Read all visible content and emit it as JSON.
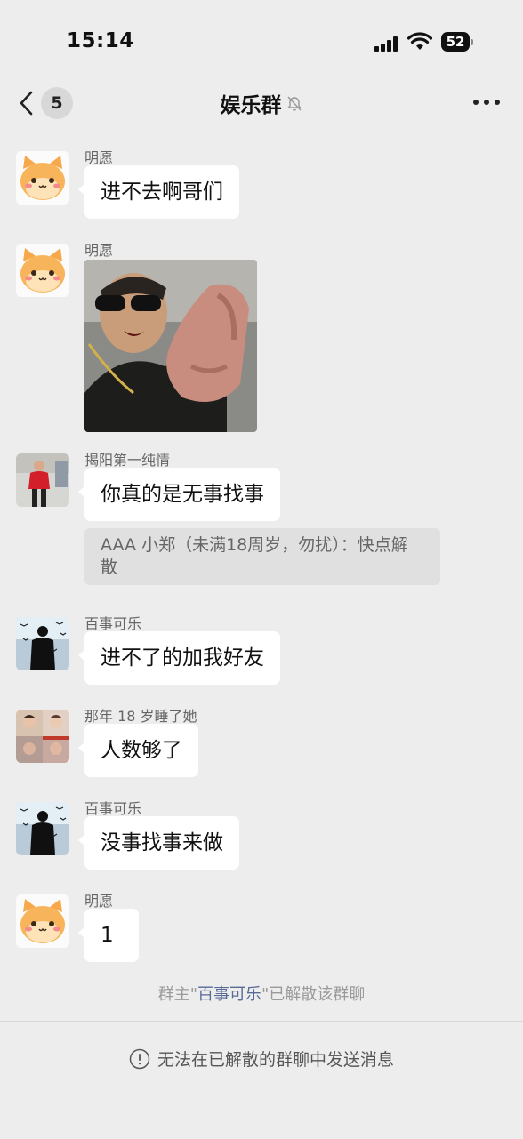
{
  "status_bar": {
    "time": "15:14",
    "battery": "52",
    "icons": [
      "cellular-signal-icon",
      "wifi-icon",
      "battery-icon"
    ]
  },
  "nav": {
    "back_icon": "chevron-left-icon",
    "unread_count": "5",
    "title": "娱乐群",
    "mute_icon": "muted-bell-icon",
    "more_icon": "more-dots-icon"
  },
  "messages": [
    {
      "sender": "明愿",
      "text": "进不去啊哥们",
      "avatar": "cartoon-cat-avatar"
    },
    {
      "sender": "明愿",
      "type": "image",
      "avatar": "cartoon-cat-avatar"
    },
    {
      "sender": "揭阳第一纯情",
      "text": "你真的是无事找事",
      "avatar": "person-red-shirt-avatar",
      "quote": "AAA 小郑（未满18周岁，勿扰）：快点解散"
    },
    {
      "sender": "百事可乐",
      "text": "进不了的加我好友",
      "avatar": "silhouette-birds-avatar"
    },
    {
      "sender": "那年 18 岁睡了她",
      "text": "人数够了",
      "avatar": "photo-collage-avatar"
    },
    {
      "sender": "百事可乐",
      "text": "没事找事来做",
      "avatar": "silhouette-birds-avatar"
    },
    {
      "sender": "明愿",
      "text": "1",
      "avatar": "cartoon-cat-avatar"
    }
  ],
  "system_message": {
    "prefix": "群主\"",
    "owner": "百事可乐",
    "suffix": "\"已解散该群聊"
  },
  "bottom": {
    "icon": "info-circle-icon",
    "text": "无法在已解散的群聊中发送消息"
  },
  "colors": {
    "background": "#ededed",
    "bubble": "#ffffff",
    "link": "#576b95",
    "quote_bg": "#e0e0e0"
  }
}
